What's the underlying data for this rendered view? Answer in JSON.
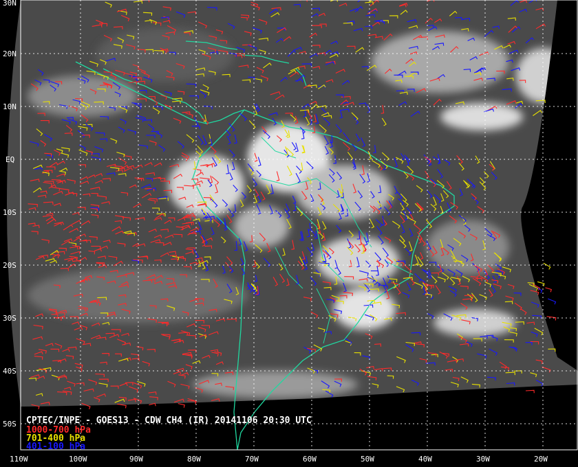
{
  "title": "CPTEC/INPE - GOES13 - CDW CH4 (IR) 20141106 20:30 UTC",
  "legend": [
    {
      "label": "1000-700 hPa",
      "color": "#ff2a2a"
    },
    {
      "label": "701-400 hPa",
      "color": "#e8e000"
    },
    {
      "label": "401-100 hPa",
      "color": "#1818ff"
    }
  ],
  "lat_labels": [
    "30N",
    "20N",
    "10N",
    "EQ",
    "10S",
    "20S",
    "30S",
    "40S",
    "50S"
  ],
  "lon_labels": [
    "110W",
    "100W",
    "90W",
    "80W",
    "70W",
    "60W",
    "50W",
    "40W",
    "30W",
    "20W"
  ],
  "coast_color": "#20d8a0",
  "background": "#000000"
}
